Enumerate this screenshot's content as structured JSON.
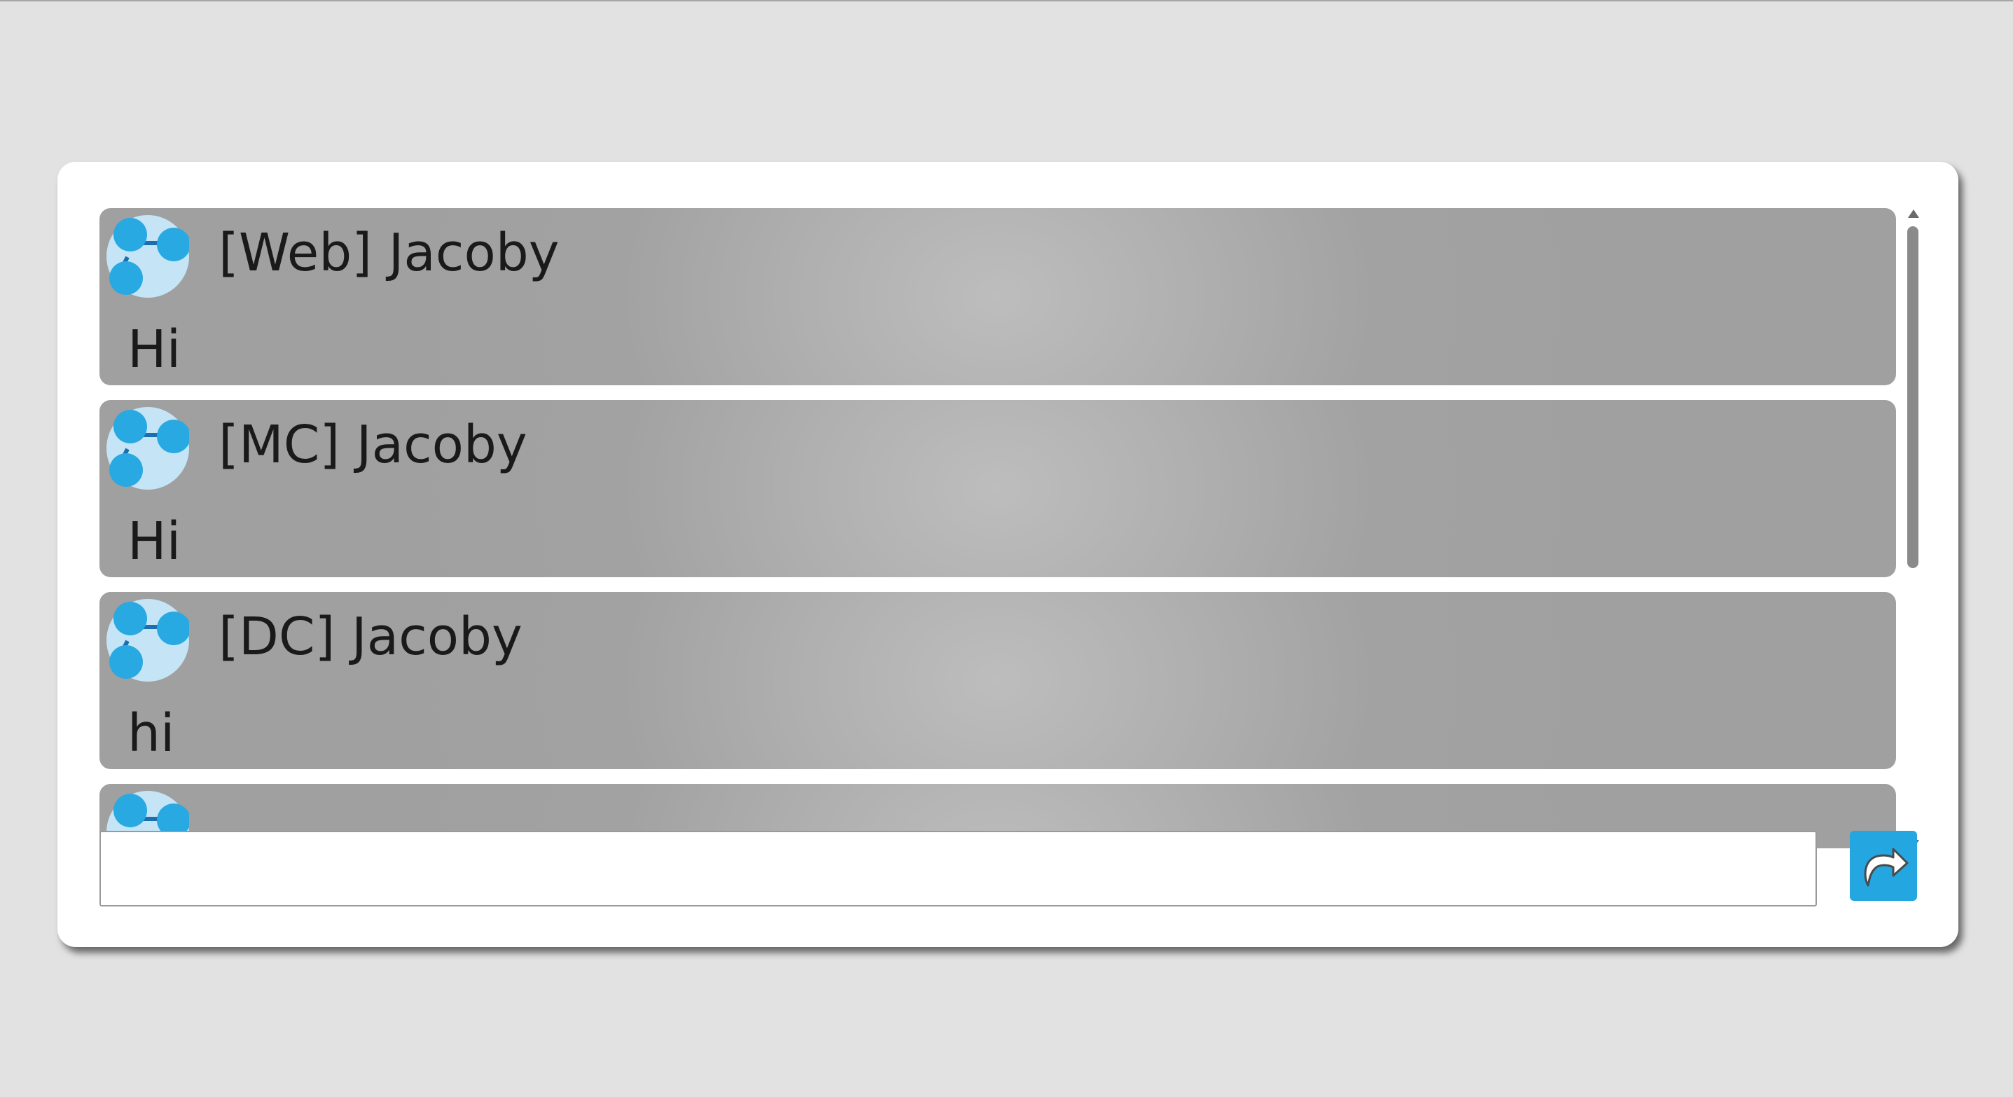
{
  "chat": {
    "messages": [
      {
        "sender": "[Web] Jacoby",
        "text": "Hi",
        "avatar_icon": "network-nodes-icon"
      },
      {
        "sender": "[MC] Jacoby",
        "text": "Hi",
        "avatar_icon": "network-nodes-icon"
      },
      {
        "sender": "[DC] Jacoby",
        "text": "hi",
        "avatar_icon": "network-nodes-icon"
      },
      {
        "sender": "",
        "text": "",
        "avatar_icon": "network-nodes-icon"
      }
    ],
    "input": {
      "value": "",
      "placeholder": ""
    },
    "send_button": {
      "icon": "redo-arrow-icon",
      "color": "#24a7e0"
    }
  },
  "colors": {
    "background": "#e2e2e2",
    "panel": "#ffffff",
    "message_bg": "#a2a2a2",
    "accent": "#24a7e0",
    "avatar_bg": "#c5e5f7"
  }
}
